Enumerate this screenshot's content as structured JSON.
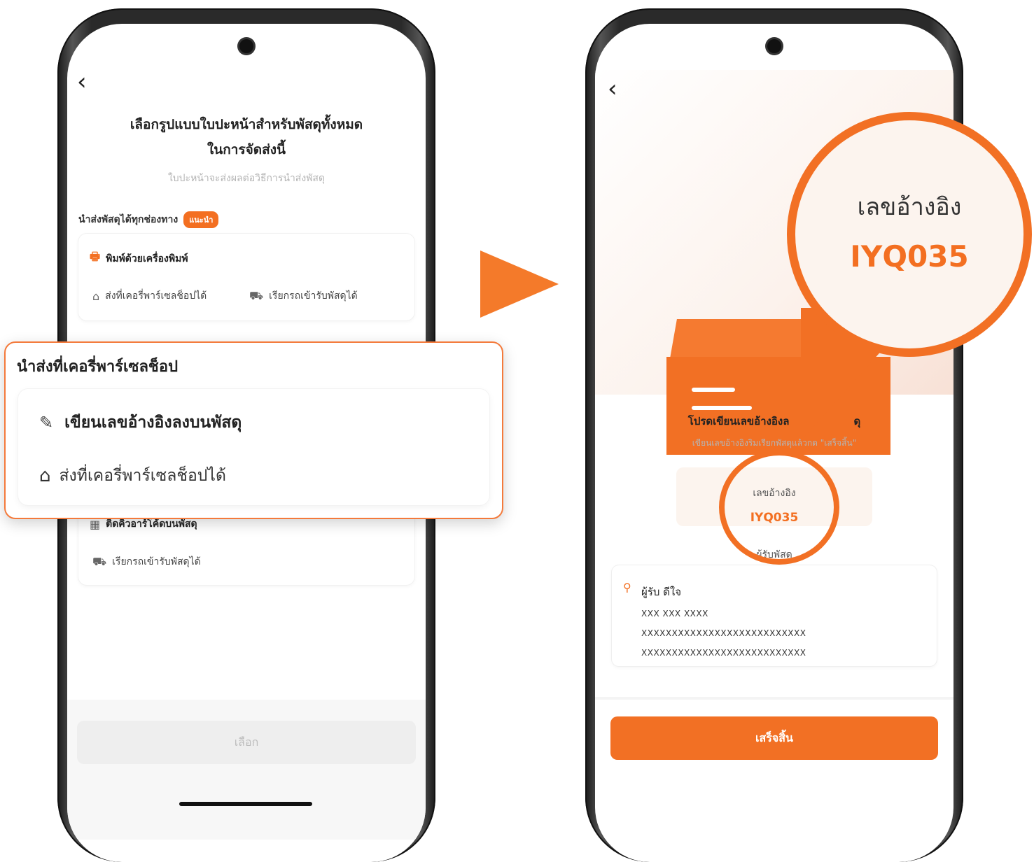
{
  "left_screen": {
    "title_line1": "เลือกรูปแบบใบปะหน้าสำหรับพัสดุทั้งหมด",
    "title_line2": "ในการจัดส่งนี้",
    "subtitle": "ใบปะหน้าจะส่งผลต่อวิธีการนำส่งพัสดุ",
    "section_label": "นำส่งพัสดุได้ทุกช่องทาง",
    "recommend_badge": "แนะนำ",
    "option1": {
      "title": "พิมพ์ด้วยเครื่องพิมพ์",
      "feature_a": "ส่งที่เคอรี่พาร์เซลช็อปได้",
      "feature_b": "เรียกรถเข้ารับพัสดุได้"
    },
    "option2": {
      "title": "ติดคิวอาร์โค้ดบนพัสดุ",
      "feature_a": "เรียกรถเข้ารับพัสดุได้"
    },
    "select_button": "เลือก"
  },
  "popup": {
    "title": "นำส่งที่เคอรี่พาร์เซลช็อป",
    "row1": "เขียนเลขอ้างอิงลงบนพัสดุ",
    "row2": "ส่งที่เคอรี่พาร์เซลช็อปได้"
  },
  "right_screen": {
    "title": "โปรดเขียนเลขอ้างอิงล",
    "title_tail": "ดุ",
    "subtitle": "เขียนเลขอ้างอิงริมเรียกพัสดุแล้วกด \"เสร็จสิ้น\"",
    "ref_label": "เลขอ้างอิง",
    "ref_code": "IYQ035",
    "receiver_label": "ผู้รับพัสดุ",
    "receiver_name": "ผู้รับ ดีใจ",
    "phone": "XXX XXX XXXX",
    "address_line1": "XXXXXXXXXXXXXXXXXXXXXXXXXXX",
    "address_line2": "XXXXXXXXXXXXXXXXXXXXXXXXXXX",
    "done_button": "เสร็จสิ้น"
  },
  "magnifier": {
    "label": "เลขอ้างอิง",
    "code": "IYQ035"
  },
  "colors": {
    "accent": "#f27024",
    "muted_text": "#b5b5b5"
  },
  "icons": [
    "back-chevron-icon",
    "printer-icon",
    "store-icon",
    "truck-icon",
    "qr-code-icon",
    "pencil-icon",
    "location-pin-icon",
    "play-arrow-icon"
  ]
}
